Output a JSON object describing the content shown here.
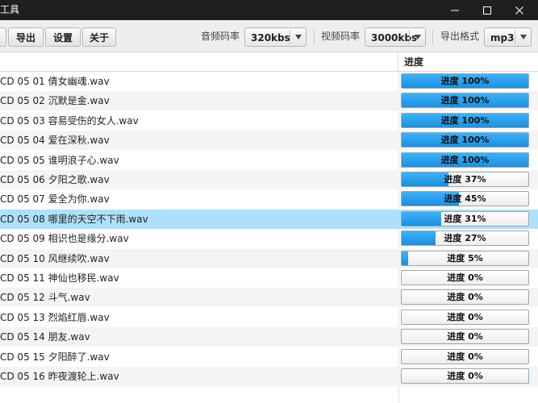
{
  "window": {
    "title": "工具",
    "minimize_icon": "minimize-icon",
    "maximize_icon": "maximize-icon",
    "close_icon": "close-icon"
  },
  "toolbar": {
    "export_label": "导出",
    "settings_label": "设置",
    "about_label": "关于",
    "audio_bitrate_label": "音频码率",
    "audio_bitrate_value": "320kbs",
    "video_bitrate_label": "视频码率",
    "video_bitrate_value": "3000kbs",
    "export_format_label": "导出格式",
    "export_format_value": "mp3"
  },
  "table": {
    "progress_header": "进度",
    "progress_fill_color": "#1a90e2",
    "selected_row_color": "#aee0fb",
    "rows": [
      {
        "name": "CD 05 01 倩女幽魂.wav",
        "progress": 100,
        "progress_text": "进度 100%"
      },
      {
        "name": "CD 05 02 沉默是金.wav",
        "progress": 100,
        "progress_text": "进度 100%"
      },
      {
        "name": "CD 05 03 容易受伤的女人.wav",
        "progress": 100,
        "progress_text": "进度 100%"
      },
      {
        "name": "CD 05 04 爱在深秋.wav",
        "progress": 100,
        "progress_text": "进度 100%"
      },
      {
        "name": "CD 05 05 谁明浪子心.wav",
        "progress": 100,
        "progress_text": "进度 100%"
      },
      {
        "name": "CD 05 06 夕阳之歌.wav",
        "progress": 37,
        "progress_text": "进度 37%"
      },
      {
        "name": "CD 05 07 爱全为你.wav",
        "progress": 45,
        "progress_text": "进度 45%"
      },
      {
        "name": "CD 05 08 哪里的天空不下雨.wav",
        "progress": 31,
        "progress_text": "进度 31%",
        "selected": true
      },
      {
        "name": "CD 05 09 相识也是缘分.wav",
        "progress": 27,
        "progress_text": "进度 27%"
      },
      {
        "name": "CD 05 10 风继续吹.wav",
        "progress": 5,
        "progress_text": "进度 5%"
      },
      {
        "name": "CD 05 11 神仙也移民.wav",
        "progress": 0,
        "progress_text": "进度 0%"
      },
      {
        "name": "CD 05 12 斗气.wav",
        "progress": 0,
        "progress_text": "进度 0%"
      },
      {
        "name": "CD 05 13 烈焰红唇.wav",
        "progress": 0,
        "progress_text": "进度 0%"
      },
      {
        "name": "CD 05 14 朋友.wav",
        "progress": 0,
        "progress_text": "进度 0%"
      },
      {
        "name": "CD 05 15 夕阳醉了.wav",
        "progress": 0,
        "progress_text": "进度 0%"
      },
      {
        "name": "CD 05 16 昨夜渡轮上.wav",
        "progress": 0,
        "progress_text": "进度 0%"
      }
    ]
  }
}
